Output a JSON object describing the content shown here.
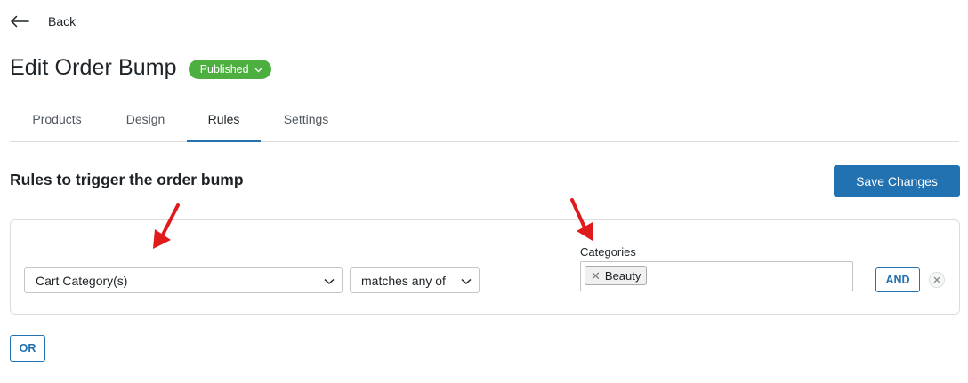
{
  "header": {
    "back_label": "Back",
    "title": "Edit Order Bump",
    "status": "Published"
  },
  "tabs": [
    {
      "label": "Products",
      "active": false
    },
    {
      "label": "Design",
      "active": false
    },
    {
      "label": "Rules",
      "active": true
    },
    {
      "label": "Settings",
      "active": false
    }
  ],
  "rules": {
    "section_title": "Rules to trigger the order bump",
    "save_label": "Save Changes",
    "rule": {
      "field_select": "Cart Category(s)",
      "operator_select": "matches any of",
      "categories_label": "Categories",
      "selected_tags": [
        "Beauty"
      ],
      "and_label": "AND"
    },
    "or_label": "OR"
  },
  "colors": {
    "primary": "#2271b1",
    "published_badge": "#4caf3f",
    "annotation_arrow": "#e01b1b"
  },
  "icons": {
    "back": "arrow-left-icon",
    "badge_dropdown": "chevron-down-icon",
    "select_dropdown": "chevron-down-icon",
    "tag_remove": "close-icon",
    "rule_remove": "close-icon"
  }
}
